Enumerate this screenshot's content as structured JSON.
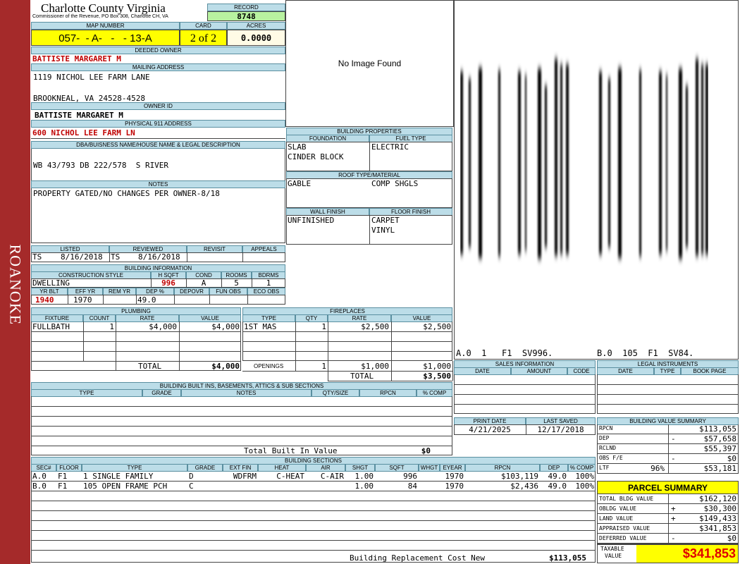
{
  "sidebar": {
    "label": "ROANOKE",
    "color": "#a52a2a"
  },
  "county": {
    "title": "Charlotte County Virginia",
    "subtitle": "Commissioner of the Revenue, PO Box 308, Charlotte CH, VA"
  },
  "record": {
    "label": "RECORD",
    "value": "8748"
  },
  "map_number": {
    "label": "MAP NUMBER",
    "value": "057-  - A-   -   - 13-A"
  },
  "card": {
    "label": "CARD",
    "value": "2 of 2"
  },
  "acres": {
    "label": "ACRES",
    "value": "0.0000"
  },
  "deeded_owner": {
    "label": "DEEDED OWNER",
    "value": "BATTISTE MARGARET M"
  },
  "mailing_address": {
    "label": "MAILING ADDRESS",
    "line1": "1119 NICHOL LEE FARM LANE",
    "line2": "BROOKNEAL, VA 24528-4528"
  },
  "owner_id": {
    "label": "OWNER ID",
    "value": "BATTISTE MARGARET M"
  },
  "physical_address": {
    "label": "PHYSICAL 911 ADDRESS",
    "value": "600 NICHOL LEE FARM LN"
  },
  "legal_desc": {
    "label": "DBA/BUISNESS NAME/HOUSE NAME & LEGAL DESCRIPTION",
    "value": "WB 43/793 DB 222/578  S RIVER"
  },
  "notes": {
    "label": "NOTES",
    "value": "PROPERTY GATED/NO CHANGES PER OWNER-8/18"
  },
  "image": {
    "text": "No Image Found"
  },
  "building_properties": {
    "label": "BUILDING PROPERTIES",
    "foundation_label": "FOUNDATION",
    "foundation": [
      "SLAB",
      "CINDER BLOCK"
    ],
    "fuel_label": "FUEL TYPE",
    "fuel": "ELECTRIC",
    "roof_label": "ROOF TYPE/MATERIAL",
    "roof_type": "GABLE",
    "roof_material": "COMP SHGLS",
    "wall_label": "WALL FINISH",
    "wall": "UNFINISHED",
    "floor_label": "FLOOR FINISH",
    "floor": [
      "CARPET",
      "VINYL"
    ]
  },
  "listing": {
    "listed_label": "LISTED",
    "reviewed_label": "REVIEWED",
    "revisit_label": "REVISIT",
    "appeals_label": "APPEALS",
    "listed_by": "TS",
    "listed_date": "8/16/2018",
    "reviewed_by": "TS",
    "reviewed_date": "8/16/2018"
  },
  "building_info": {
    "label": "BUILDING INFORMATION",
    "cols": [
      "CONSTRUCTION STYLE",
      "H SQFT",
      "COND",
      "ROOMS",
      "BDRMS"
    ],
    "style": "DWELLING",
    "hsqft": "996",
    "cond": "A",
    "rooms": "5",
    "bdrms": "1",
    "cols2": [
      "YR BLT",
      "EFF YR",
      "REM YR",
      "DEP %",
      "DEPOVR",
      "FUN OBS",
      "ECO OBS"
    ],
    "yr_blt": "1940",
    "eff_yr": "1970",
    "rem_yr": "",
    "dep": "49.0"
  },
  "plumbing": {
    "label": "PLUMBING",
    "cols": [
      "FIXTURE",
      "COUNT",
      "RATE",
      "VALUE"
    ],
    "rows": [
      {
        "fixture": "FULLBATH",
        "count": "1",
        "rate": "$4,000",
        "value": "$4,000"
      }
    ],
    "total_label": "TOTAL",
    "total": "$4,000"
  },
  "fireplaces": {
    "label": "FIREPLACES",
    "cols": [
      "TYPE",
      "QTY",
      "RATE",
      "VALUE"
    ],
    "rows": [
      {
        "type": "1ST MAS",
        "qty": "1",
        "rate": "$2,500",
        "value": "$2,500"
      }
    ],
    "openings_label": "OPENINGS",
    "openings_qty": "1",
    "openings_rate": "$1,000",
    "openings_value": "$1,000",
    "total_label": "TOTAL",
    "total": "$3,500"
  },
  "built_ins": {
    "label": "BUILDING BUILT INS, BASEMENTS, ATTICS & SUB SECTIONS",
    "cols": [
      "TYPE",
      "GRADE",
      "NOTES",
      "QTY/SIZE",
      "RPCN",
      "% COMP"
    ],
    "total_label": "Total Built In Value",
    "total": "$0"
  },
  "sketch": {
    "caption_a": "A.0  1   F1  SV996.",
    "caption_b": "B.0  105  F1  SV84."
  },
  "sales": {
    "label": "SALES INFORMATION",
    "cols": [
      "DATE",
      "AMOUNT",
      "CODE"
    ]
  },
  "legal_instruments": {
    "label": "LEGAL INSTRUMENTS",
    "cols": [
      "DATE",
      "TYPE",
      "BOOK PAGE"
    ]
  },
  "dates": {
    "print_label": "PRINT DATE",
    "print": "4/21/2025",
    "saved_label": "LAST SAVED",
    "saved": "12/17/2018"
  },
  "building_sections": {
    "label": "BUILDING SECTIONS",
    "cols": [
      "SEC#",
      "FLOOR",
      "TYPE",
      "GRADE",
      "EXT FIN",
      "HEAT",
      "AIR",
      "SHGT",
      "SQFT",
      "WHGT",
      "EYEAR",
      "RPCN",
      "DEP",
      "% COMP"
    ],
    "rows": [
      {
        "sec": "A.0",
        "floor": "F1",
        "type": "1 SINGLE FAMILY",
        "grade": "D",
        "ext": "WDFRM",
        "heat": "C-HEAT",
        "air": "C-AIR",
        "shgt": "1.00",
        "sqft": "996",
        "whgt": "",
        "eyear": "1970",
        "rpcn": "$103,119",
        "dep": "49.0",
        "comp": "100%"
      },
      {
        "sec": "B.0",
        "floor": "F1",
        "type": "105 OPEN FRAME PCH",
        "grade": "C",
        "ext": "",
        "heat": "",
        "air": "",
        "shgt": "1.00",
        "sqft": "84",
        "whgt": "",
        "eyear": "1970",
        "rpcn": "$2,436",
        "dep": "49.0",
        "comp": "100%"
      }
    ],
    "replacement_label": "Building Replacement Cost New",
    "replacement": "$113,055"
  },
  "value_summary": {
    "label": "BUILDING VALUE SUMMARY",
    "rows": [
      {
        "label": "RPCN",
        "sign": "",
        "value": "$113,055"
      },
      {
        "label": "DEP",
        "sign": "-",
        "value": "$57,658"
      },
      {
        "label": "RCLND",
        "sign": "",
        "value": "$55,397"
      },
      {
        "label": "OBS F/E",
        "sign": "-",
        "value": "$0"
      },
      {
        "label": "LTF",
        "pct": "96%",
        "sign": "",
        "value": "$53,181"
      }
    ]
  },
  "parcel_summary": {
    "label": "PARCEL SUMMARY",
    "rows": [
      {
        "label": "TOTAL BLDG VALUE",
        "sign": "",
        "value": "$162,120"
      },
      {
        "label": "OBLDG VALUE",
        "sign": "+",
        "value": "$30,300"
      },
      {
        "label": "LAND VALUE",
        "sign": "+",
        "value": "$149,433"
      },
      {
        "label": "APPRAISED VALUE",
        "sign": "",
        "value": "$341,853"
      },
      {
        "label": "DEFERRED VALUE",
        "sign": "-",
        "value": "$0"
      }
    ],
    "taxable_label_1": "TAXABLE",
    "taxable_label_2": "VALUE",
    "taxable": "$341,853"
  }
}
